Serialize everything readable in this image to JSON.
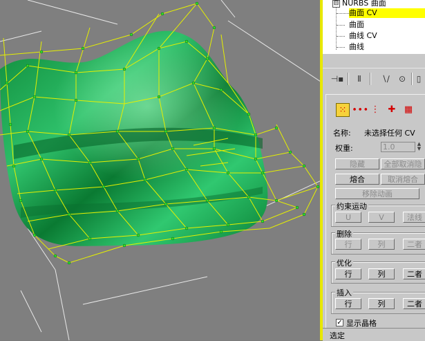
{
  "scene_tree": {
    "root_label": "NURBS 曲面",
    "expander_symbol": "⊟",
    "items": [
      {
        "label": "曲面 CV",
        "selected": true
      },
      {
        "label": "曲面",
        "selected": false
      },
      {
        "label": "曲线 CV",
        "selected": false
      },
      {
        "label": "曲线",
        "selected": false
      }
    ]
  },
  "toolbar": {
    "icons": [
      "pin-stack-icon",
      "funnel-icon",
      "show-end-result-icon",
      "make-unique-icon",
      "remove-modifier-icon"
    ],
    "glyphs": [
      "⊣▪",
      "Ⅱ",
      "∖∕",
      "⊙",
      "▯"
    ]
  },
  "selection_level": {
    "icons": [
      "single-cv-icon",
      "row-cv-icon",
      "column-cv-icon",
      "row-column-cv-icon",
      "all-cv-icon"
    ],
    "glyphs": [
      "⁙",
      "∙∙∙",
      "⋮",
      "✚",
      "▦"
    ],
    "active_index": 0
  },
  "cv_panel": {
    "name_label": "名称:",
    "name_value": "未选择任何 CV",
    "weight_label": "权重:",
    "weight_value": "1.0",
    "hide_button": "隐藏",
    "unhide_all_button": "全部取消隐",
    "fuse_button": "熔合",
    "unfuse_button": "取消熔合",
    "remove_animation_button": "移除动画",
    "constrained_motion": {
      "title": "约束运动",
      "u": "U",
      "v": "V",
      "normal": "法线"
    },
    "delete_group": {
      "title": "删除",
      "row": "行",
      "col": "列",
      "both": "二者"
    },
    "refine_group": {
      "title": "优化",
      "row": "行",
      "col": "列",
      "both": "二者"
    },
    "insert_group": {
      "title": "插入",
      "row": "行",
      "col": "列",
      "both": "二者"
    },
    "display_lattice_label": "显示晶格",
    "display_lattice_checked": true,
    "selected_label": "选定"
  },
  "colors": {
    "viewport_bg": "#7f7f7f",
    "surface_green": "#1aa84a",
    "lattice_yellow": "#e6f000",
    "cv_point_green": "#30e030",
    "selection_highlight": "#ffff00",
    "active_border": "#e8e800"
  }
}
